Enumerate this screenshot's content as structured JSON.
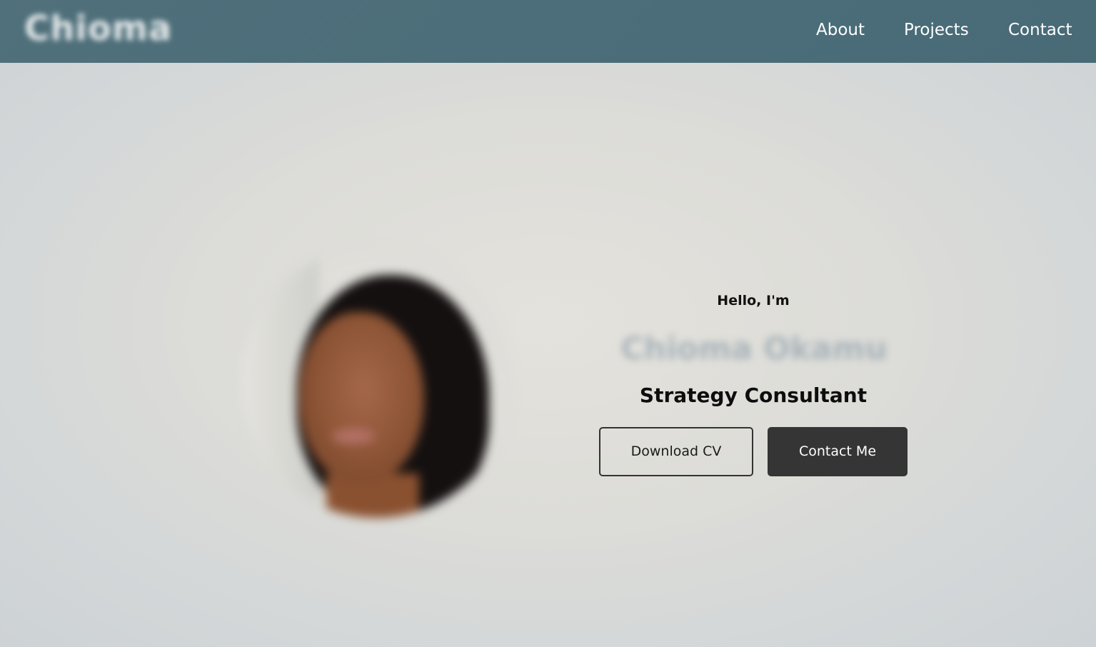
{
  "navbar": {
    "logo_text": "Chioma",
    "links": [
      {
        "label": "About"
      },
      {
        "label": "Projects"
      },
      {
        "label": "Contact"
      }
    ],
    "background_color": "#4a6d79"
  },
  "hero": {
    "profile_photo_alt": "profile-picture",
    "greeting": "Hello, I'm",
    "name": "Chioma Okamu",
    "title": "Strategy Consultant",
    "buttons": {
      "download_cv": "Download CV",
      "contact_me": "Contact Me"
    }
  },
  "colors": {
    "button_filled": "#353535",
    "text_primary": "#111111"
  }
}
